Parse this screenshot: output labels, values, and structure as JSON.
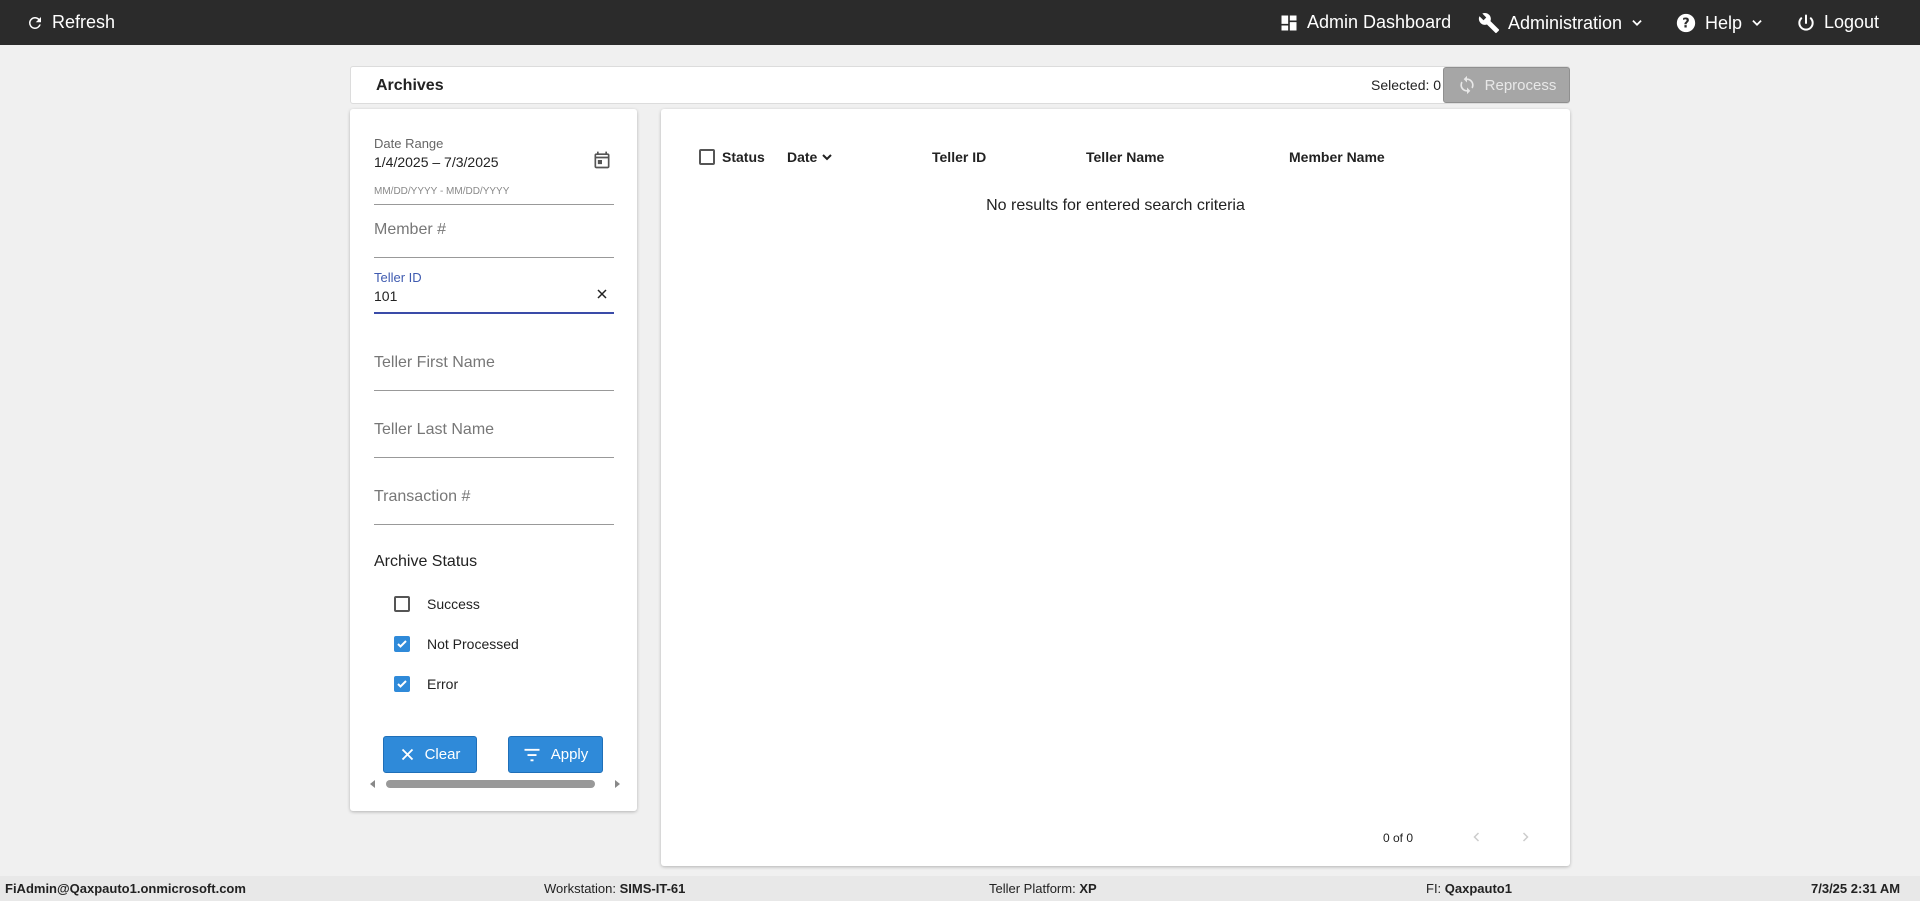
{
  "topbar": {
    "refresh_label": "Refresh",
    "admin_dashboard_label": "Admin Dashboard",
    "administration_label": "Administration",
    "help_label": "Help",
    "logout_label": "Logout"
  },
  "header": {
    "title": "Archives",
    "selected_label": "Selected: 0",
    "reprocess_label": "Reprocess"
  },
  "filters": {
    "date_range_label": "Date Range",
    "date_range_value": "1/4/2025 – 7/3/2025",
    "date_range_hint": "MM/DD/YYYY - MM/DD/YYYY",
    "member_placeholder": "Member #",
    "teller_id_label": "Teller ID",
    "teller_id_value": "101",
    "teller_first_placeholder": "Teller First Name",
    "teller_last_placeholder": "Teller Last Name",
    "transaction_placeholder": "Transaction #",
    "archive_status_heading": "Archive Status",
    "statuses": [
      {
        "label": "Success",
        "checked": false
      },
      {
        "label": "Not Processed",
        "checked": true
      },
      {
        "label": "Error",
        "checked": true
      }
    ],
    "clear_label": "Clear",
    "apply_label": "Apply"
  },
  "results": {
    "columns": {
      "status": "Status",
      "date": "Date",
      "teller_id": "Teller ID",
      "teller_name": "Teller Name",
      "member_name": "Member Name"
    },
    "empty_message": "No results for entered search criteria",
    "paging_text": "0 of 0"
  },
  "footer": {
    "user": "FiAdmin@Qaxpauto1.onmicrosoft.com",
    "workstation_label": "Workstation:",
    "workstation_value": "SIMS-IT-61",
    "teller_platform_label": "Teller Platform:",
    "teller_platform_value": "XP",
    "fi_label": "FI:",
    "fi_value": "Qaxpauto1",
    "datetime": "7/3/25 2:31 AM"
  },
  "colors": {
    "topbar_bg": "#2b2b2b",
    "accent_blue": "#2f8ad9",
    "focus_underline": "#3a4ba8",
    "disabled_button": "#a6a6a6"
  }
}
